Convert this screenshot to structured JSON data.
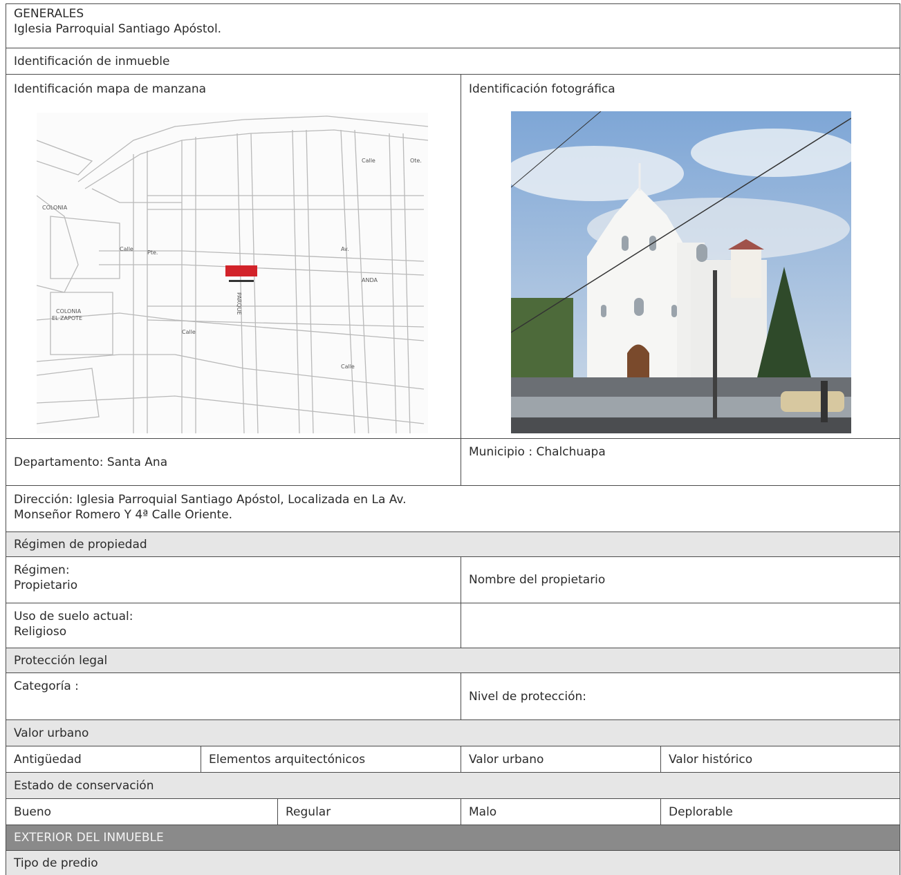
{
  "header": {
    "section": "GENERALES",
    "title": "Iglesia Parroquial Santiago Apóstol."
  },
  "identificacion": {
    "heading": "Identificación de inmueble",
    "mapa_label": "Identificación mapa de manzana",
    "foto_label": "Identificación fotográfica",
    "map_labels": [
      "COLONIA EL ZAPOTE",
      "COLONIA",
      "ANDA",
      "PARQUE",
      "Calle",
      "Ote.",
      "Pte.",
      "Av."
    ]
  },
  "ubicacion": {
    "departamento": "Departamento: Santa Ana",
    "municipio": "Municipio : Chalchuapa",
    "direccion": "Dirección: Iglesia Parroquial Santiago Apóstol, Localizada en La Av.\nMonseñor Romero Y 4ª Calle Oriente."
  },
  "regimen": {
    "heading": "Régimen de propiedad",
    "regimen": "Régimen:\n Propietario",
    "propietario": "Nombre del propietario",
    "uso_suelo": "Uso de suelo actual:\nReligioso"
  },
  "proteccion": {
    "heading": "Protección legal",
    "categoria": "Categoría :",
    "nivel": "Nivel de protección:"
  },
  "valor_urbano": {
    "heading": "Valor urbano",
    "antiguedad": "Antigüedad",
    "elementos": "Elementos arquitectónicos",
    "valor_urbano": "Valor urbano",
    "valor_historico": "Valor histórico"
  },
  "conservacion": {
    "heading": "Estado de conservación",
    "bueno": "Bueno",
    "regular": "Regular",
    "malo": "Malo",
    "deplorable": "Deplorable"
  },
  "exterior": {
    "heading": "EXTERIOR DEL INMUEBLE",
    "tipo_predio": "Tipo de predio"
  },
  "colors": {
    "border": "#4a4a4a",
    "section_grey": "#e6e6e6",
    "dark_header": "#8a8a8a",
    "map_red": "#d2232a"
  }
}
